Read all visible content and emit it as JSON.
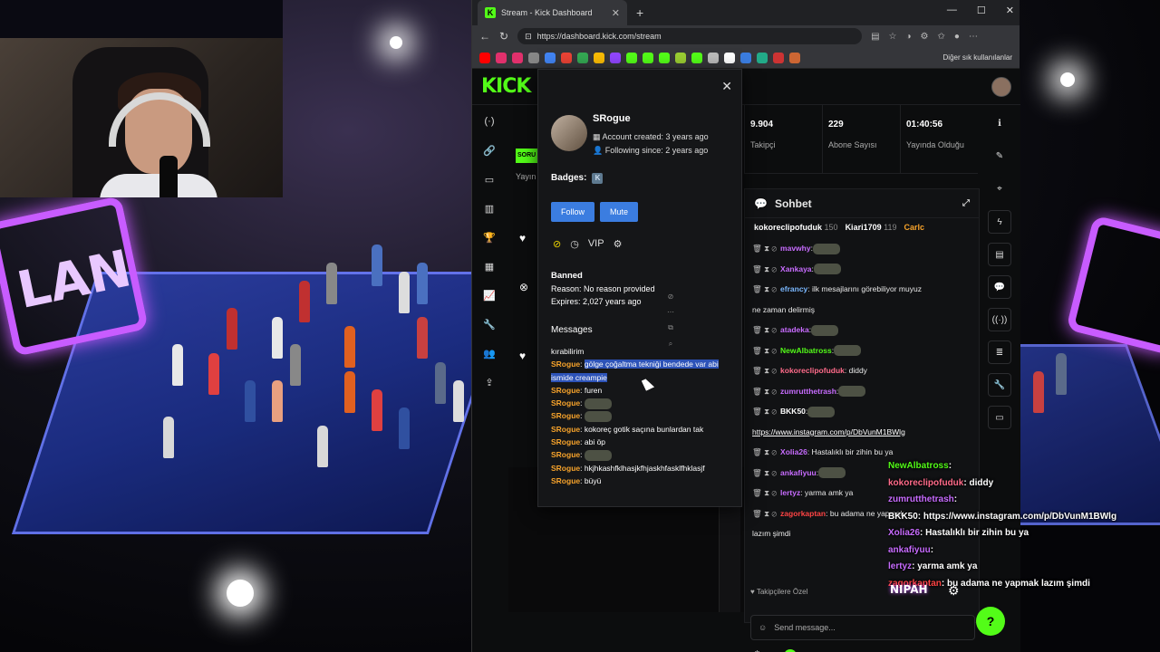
{
  "browser": {
    "tab_title": "Stream - Kick Dashboard",
    "new_tab": "+",
    "window_controls": [
      "—",
      "☐",
      "✕"
    ],
    "url": "https://dashboard.kick.com/stream",
    "bookmarks_other": "Diğer sık kullanılanlar",
    "bookmark_colors": [
      "#ff0000",
      "#e1306c",
      "#e1306c",
      "#888888",
      "#4285f4",
      "#ea4335",
      "#34a853",
      "#fbbc05",
      "#9146ff",
      "#53fc18",
      "#53fc18",
      "#53fc18",
      "#9acd32",
      "#53fc18",
      "#bbbbbb",
      "#ffffff",
      "#3b7de0",
      "#22aa88",
      "#cc3333",
      "#cc6633"
    ]
  },
  "dashboard": {
    "logo": "KICK",
    "status_pill": "SORU",
    "label_yayin": "Yayın",
    "stats": [
      {
        "value": "9.904",
        "label": "Takipçi"
      },
      {
        "value": "229",
        "label": "Abone Sayısı"
      },
      {
        "value": "01:40:56",
        "label": "Yayında Olduğu"
      }
    ],
    "left_nav_icons": [
      "broadcast-icon",
      "link-icon",
      "window-icon",
      "chart-icon",
      "trophy-icon",
      "media-icon",
      "analytics-icon",
      "wrench-icon",
      "users-icon",
      "upload-icon"
    ],
    "right_rail_icons": [
      "info-icon",
      "pencil-icon",
      "target-icon",
      "bolt-icon",
      "note-icon",
      "chat-bubble-icon",
      "signal-icon",
      "list-icon",
      "wrench-icon",
      "window-icon"
    ],
    "right_rail_glyphs": [
      "ℹ",
      "✎",
      "⌖",
      "ϟ",
      "▤",
      "💬",
      "((·))",
      "≣",
      "🔧",
      "▭"
    ],
    "left_nav_glyphs": [
      "(·)",
      "🔗",
      "▭",
      "▥",
      "🏆",
      "▦",
      "📈",
      "🔧",
      "👥",
      "⇪"
    ]
  },
  "chat": {
    "title": "Sohbet",
    "leaders": [
      {
        "name": "kokoreclipofuduk",
        "count": "150"
      },
      {
        "name": "Kiari1709",
        "count": "119"
      },
      {
        "name": "Carlc",
        "count": ""
      }
    ],
    "messages": [
      {
        "user": "mavwhy",
        "user_color": "#c86cff",
        "text": ""
      },
      {
        "user": "Xankaya",
        "user_color": "#c86cff",
        "text": ""
      },
      {
        "user": "efrancy",
        "user_color": "#7ab8ff",
        "text": " ilk mesajlarını görebiliyor muyuz"
      },
      {
        "user": "",
        "user_color": "#ffffff",
        "text": "ne zaman delirmiş"
      },
      {
        "user": "atadeka",
        "user_color": "#c86cff",
        "text": ""
      },
      {
        "user": "NewAlbatross",
        "user_color": "#53fc18",
        "text": ""
      },
      {
        "user": "kokoreclipofuduk",
        "user_color": "#ff6b8a",
        "text": " diddy"
      },
      {
        "user": "zumrutthetrash",
        "user_color": "#c86cff",
        "text": ""
      },
      {
        "user": "BKK50",
        "user_color": "#ffffff",
        "text": ""
      },
      {
        "user": "",
        "user_color": "#ffffff",
        "text": "https://www.instagram.com/p/DbVunM1BWlg"
      },
      {
        "user": "Xolia26",
        "user_color": "#c86cff",
        "text": " Hastalıklı bir zihin bu ya"
      },
      {
        "user": "ankafiyuu",
        "user_color": "#c86cff",
        "text": ""
      },
      {
        "user": "lertyz",
        "user_color": "#c86cff",
        "text": " yarma amk ya"
      },
      {
        "user": "zagorkaptan",
        "user_color": "#ff4444",
        "text": " bu adama ne yapmak"
      },
      {
        "user": "",
        "user_color": "#ffffff",
        "text": "lazım şimdi"
      }
    ],
    "followers_only": "Takipçilere Özel",
    "input_placeholder": "Send message..."
  },
  "user_card": {
    "username": "SRogue",
    "account_created": "Account created: 3 years ago",
    "following_since": "Following since: 2 years ago",
    "badges_label": "Badges:",
    "follow_button": "Follow",
    "mute_button": "Mute",
    "banned_title": "Banned",
    "banned_reason": "Reason: No reason provided",
    "banned_expires": "Expires: 2,027 years ago",
    "messages_title": "Messages",
    "messages": [
      {
        "user": "",
        "text": "kırabilirim"
      },
      {
        "user": "SRogue",
        "text": "gölge çoğaltma tekniği bendede var abi ismide creampie",
        "selected": true
      },
      {
        "user": "SRogue",
        "text": "furen"
      },
      {
        "user": "SRogue",
        "text": ""
      },
      {
        "user": "SRogue",
        "text": ""
      },
      {
        "user": "SRogue",
        "text": "kokoreç gotik  saçına bunlardan tak"
      },
      {
        "user": "SRogue",
        "text": "abi öp"
      },
      {
        "user": "SRogue",
        "text": ""
      },
      {
        "user": "SRogue",
        "text": "hkjhkashfklhasjkfhjaskhfasklfhklasjf"
      },
      {
        "user": "SRogue",
        "text": "büyü"
      }
    ]
  },
  "overlay": {
    "messages": [
      {
        "user": "NewAlbatross",
        "color": "#53fc18",
        "text": ""
      },
      {
        "user": "kokoreclipofuduk",
        "color": "#ff6b8a",
        "text": " diddy"
      },
      {
        "user": "zumrutthetrash",
        "color": "#c86cff",
        "text": ""
      },
      {
        "user": "BKK50",
        "color": "#ffffff",
        "text": " https://www.instagram.com/p/DbVunM1BWlg"
      },
      {
        "user": "Xolia26",
        "color": "#c86cff",
        "text": " Hastalıklı bir zihin bu ya"
      },
      {
        "user": "ankafiyuu",
        "color": "#c86cff",
        "text": ""
      },
      {
        "user": "lertyz",
        "color": "#c86cff",
        "text": " yarma amk ya"
      },
      {
        "user": "zagorkaptan",
        "color": "#ff4444",
        "text": " bu adama ne yapmak lazım şimdi"
      }
    ],
    "brand": "NIPAH"
  },
  "colors": {
    "kick_green": "#53fc18",
    "follow_blue": "#3b7de0",
    "username_orange": "#f7a32b"
  }
}
